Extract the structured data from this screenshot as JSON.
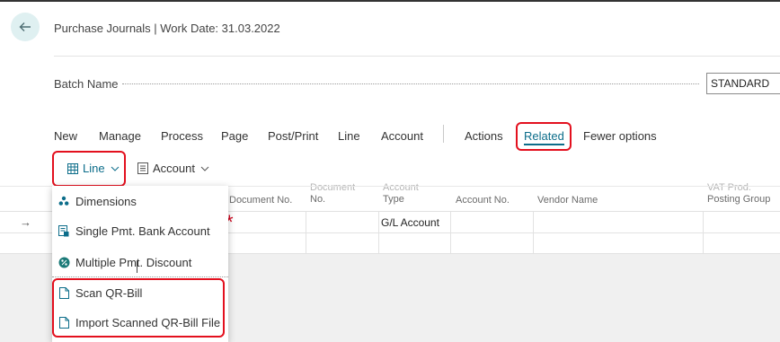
{
  "header": {
    "title": "Purchase Journals | Work Date: 31.03.2022"
  },
  "batch": {
    "label": "Batch Name",
    "value": "STANDARD"
  },
  "actionbar": {
    "items": [
      "New",
      "Manage",
      "Process",
      "Page",
      "Post/Print",
      "Line",
      "Account",
      "Actions",
      "Related",
      "Fewer options"
    ],
    "active": "Related"
  },
  "subactions": {
    "line_label": "Line",
    "account_label": "Account"
  },
  "grid": {
    "columns": [
      {
        "line1": "",
        "line2": "Document No."
      },
      {
        "line1": "Document",
        "line2": "No."
      },
      {
        "line1": "Account",
        "line2": "Type"
      },
      {
        "line1": "",
        "line2": "Account No."
      },
      {
        "line1": "",
        "line2": "Vendor Name"
      },
      {
        "line1": "VAT Prod.",
        "line2": "Posting Group"
      }
    ],
    "row": {
      "account_type": "G/L Account"
    }
  },
  "dropdown": {
    "items": [
      {
        "label": "Dimensions",
        "icon": "dimensions-icon"
      },
      {
        "label": "Single Pmt. Bank Account",
        "icon": "bank-account-icon"
      },
      {
        "label": "Multiple Pmt. Discount",
        "icon": "discount-icon"
      },
      {
        "label": "Scan QR-Bill",
        "icon": "document-icon"
      },
      {
        "label": "Import Scanned QR-Bill File",
        "icon": "document-icon"
      }
    ]
  },
  "colors": {
    "accent": "#0c6d8a",
    "highlight": "#e3101e",
    "back_button_bg": "#dff0f1"
  }
}
